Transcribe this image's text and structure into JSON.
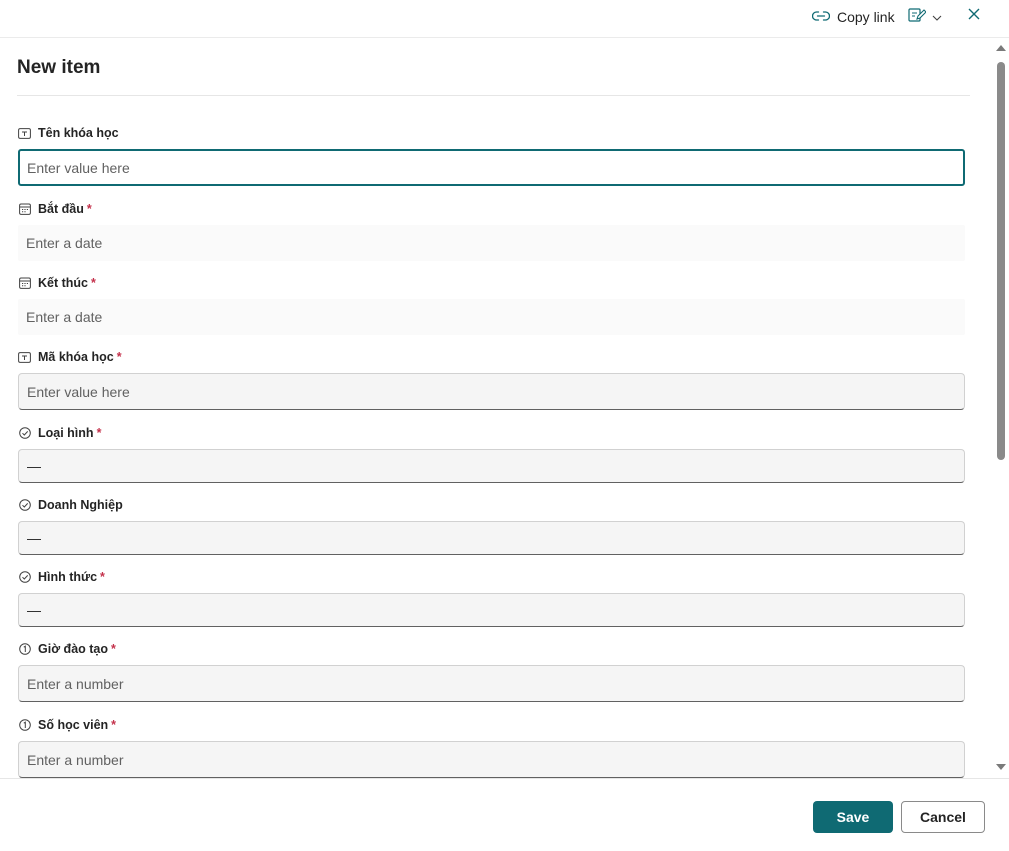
{
  "header": {
    "copy_link_label": "Copy link",
    "edit_form_icon": "edit-form-icon",
    "chevron_icon": "chevron-down-icon",
    "close_icon": "close-icon"
  },
  "form": {
    "title": "New item",
    "fields": [
      {
        "label": "Tên khóa học",
        "required": "",
        "icon": "text-field-icon",
        "placeholder": "Enter value here",
        "kind": "text"
      },
      {
        "label": "Bắt đầu",
        "required": "*",
        "icon": "calendar-icon",
        "placeholder": "Enter a date",
        "kind": "date"
      },
      {
        "label": "Kết thúc",
        "required": "*",
        "icon": "calendar-icon",
        "placeholder": "Enter a date",
        "kind": "date"
      },
      {
        "label": "Mã khóa học",
        "required": "*",
        "icon": "text-field-icon",
        "placeholder": "Enter value here",
        "kind": "text"
      },
      {
        "label": "Loại hình",
        "required": "*",
        "icon": "choice-icon",
        "value": "—",
        "kind": "choice"
      },
      {
        "label": "Doanh Nghiệp",
        "required": "",
        "icon": "choice-icon",
        "value": "—",
        "kind": "choice"
      },
      {
        "label": "Hình thức",
        "required": "*",
        "icon": "choice-icon",
        "value": "—",
        "kind": "choice"
      },
      {
        "label": "Giờ đào tạo",
        "required": "*",
        "icon": "number-icon",
        "placeholder": "Enter a number",
        "kind": "number"
      },
      {
        "label": "Số học viên",
        "required": "*",
        "icon": "number-icon",
        "placeholder": "Enter a number",
        "kind": "number"
      }
    ]
  },
  "footer": {
    "save_label": "Save",
    "cancel_label": "Cancel"
  },
  "colors": {
    "accent": "#0f6a73",
    "required": "#c4314b",
    "input_bg": "#f5f5f5"
  }
}
